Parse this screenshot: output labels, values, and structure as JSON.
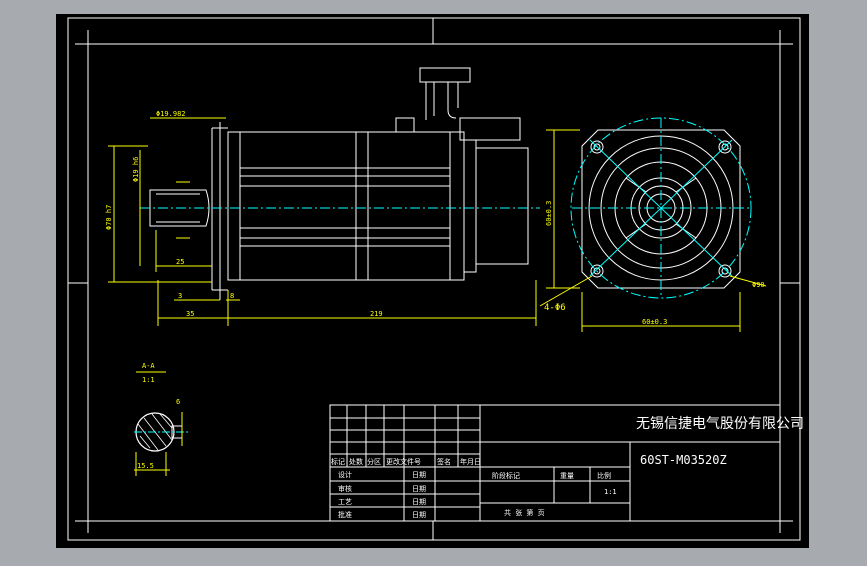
{
  "colors": {
    "background": "#a7aaaf",
    "sheet": "#000000",
    "border": "#ffffff",
    "outline": "#ffffff",
    "dimension": "#ffff00",
    "centerline": "#00ffff"
  },
  "dimensions": {
    "shaft_dia": "Φ19.982",
    "flange_dia": "Φ19 h6",
    "pilot_dia": "Φ70 h7",
    "key_length": "25",
    "shoulder": "3",
    "flange_thk": "8",
    "shaft_len": "35",
    "body_len": "219",
    "square_v": "60±0.3",
    "square_h": "60±0.3",
    "bolt_holes": "4-Φ6",
    "bolt_pcd": "Φ90",
    "section_label": "A-A",
    "section_scale": "1:1",
    "key_width": "6",
    "section_depth": "15.5"
  },
  "title_block": {
    "company": "无锡信捷电气股份有限公司",
    "drawing_number": "60ST-M03520Z",
    "rev_headers": [
      "标记",
      "处数",
      "分区",
      "更改文件号",
      "签名",
      "年月日"
    ],
    "roles": [
      "设计",
      "审核",
      "工艺",
      "批准"
    ],
    "date_label": "日期",
    "stage_header": "阶段标记",
    "weight_header": "重量",
    "scale_header": "比例",
    "scale_value": "1:1",
    "sheets_label": "共 张 第 页"
  }
}
